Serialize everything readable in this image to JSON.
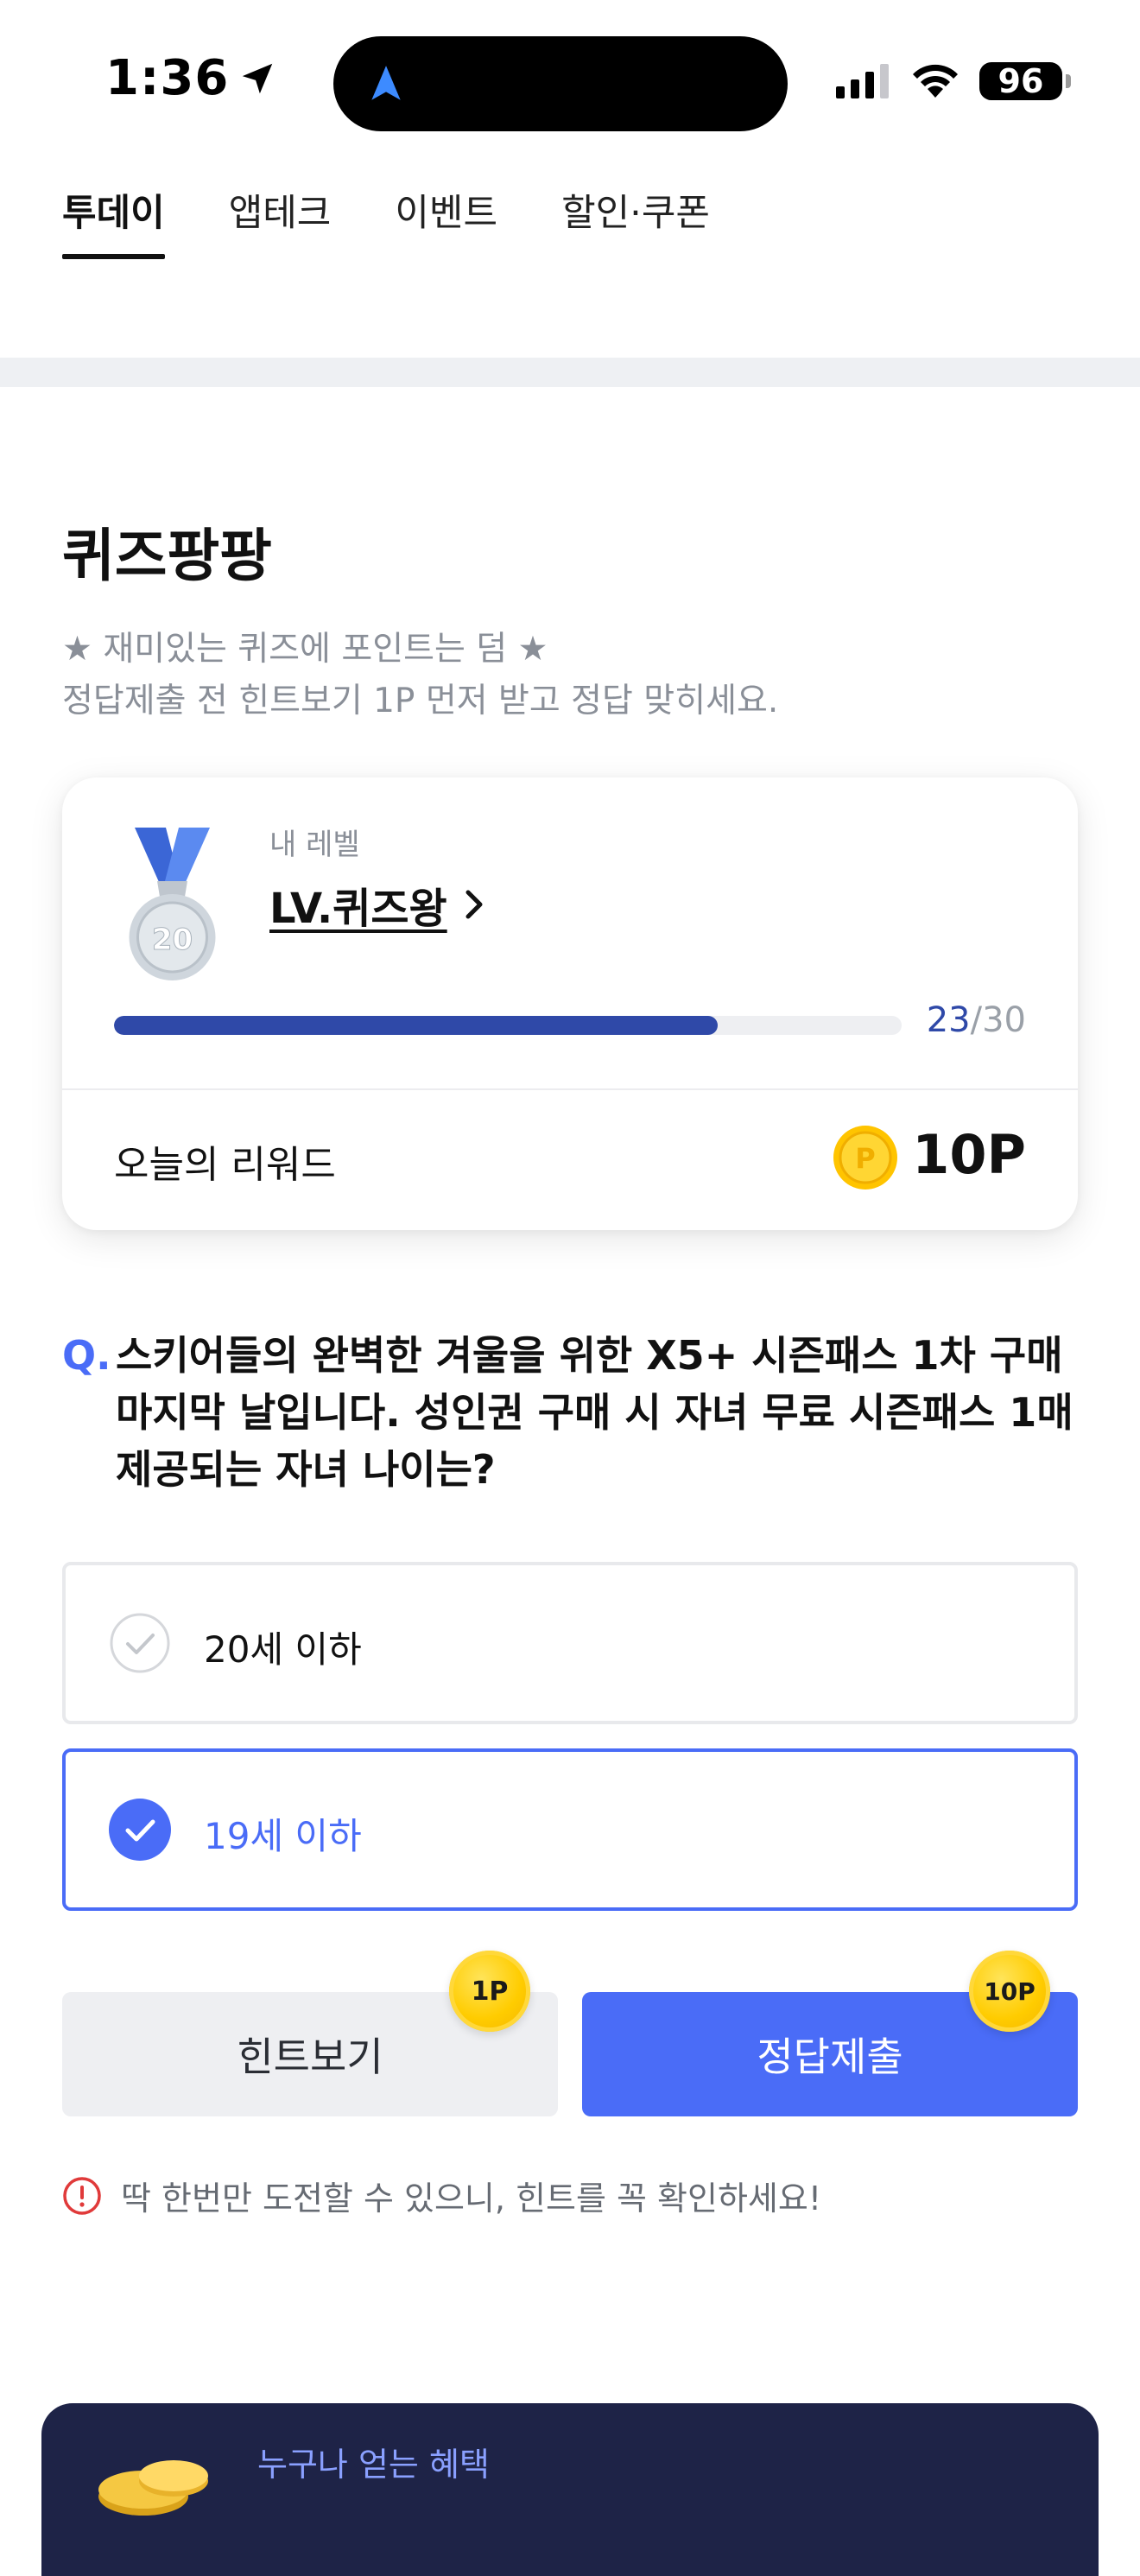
{
  "status_bar": {
    "time": "1:36",
    "battery": "96"
  },
  "tabs": [
    {
      "label": "투데이",
      "active": true
    },
    {
      "label": "앱테크",
      "active": false
    },
    {
      "label": "이벤트",
      "active": false
    },
    {
      "label": "할인·쿠폰",
      "active": false
    }
  ],
  "quiz": {
    "title": "퀴즈팡팡",
    "desc_line1": "★ 재미있는 퀴즈에 포인트는 덤 ★",
    "desc_line2": "정답제출 전 힌트보기 1P 먼저 받고 정답 맞히세요."
  },
  "level_card": {
    "label": "내 레벨",
    "level_name": "LV.퀴즈왕",
    "medal_number": "20",
    "progress_current": "23",
    "progress_total": "/30",
    "progress_fraction": 0.7667,
    "reward_label": "오늘의 리워드",
    "coin_letter": "P",
    "reward_value": "10P"
  },
  "question": {
    "prefix": "Q.",
    "line1": "스키어들의 완벽한 겨울을 위한 X5+ 시즌패스 1차 구매",
    "line2": "마지막 날입니다. 성인권 구매 시 자녀 무료 시즌패스 1매",
    "line3": "제공되는 자녀 나이는?"
  },
  "options": [
    {
      "label": "20세 이하",
      "selected": false
    },
    {
      "label": "19세 이하",
      "selected": true
    }
  ],
  "buttons": {
    "hint_label": "힌트보기",
    "hint_badge": "1P",
    "submit_label": "정답제출",
    "submit_badge": "10P"
  },
  "notice": {
    "text": "딱 한번만 도전할 수 있으니, 힌트를 꼭 확인하세요!"
  },
  "promo": {
    "text": "누구나 얻는 혜택"
  },
  "colors": {
    "accent": "#4a6cf7",
    "progress": "#2f49a8",
    "promo_bg": "#1e2347",
    "coin": "#ffcc00",
    "warning": "#e03a3a"
  }
}
